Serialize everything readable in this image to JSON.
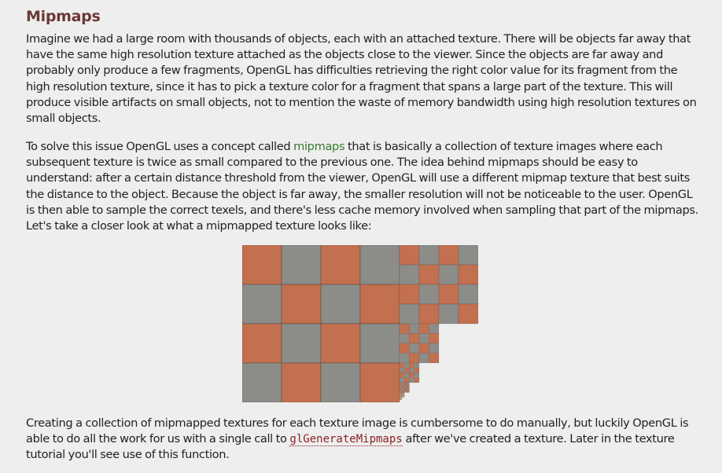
{
  "section": {
    "title": "Mipmaps"
  },
  "paragraphs": {
    "p1": "Imagine we had a large room with thousands of objects, each with an attached texture. There will be objects far away that have the same high resolution texture attached as the objects close to the viewer. Since the objects are far away and probably only produce a few fragments, OpenGL has difficulties retrieving the right color value for its fragment from the high resolution texture, since it has to pick a texture color for a fragment that spans a large part of the texture. This will produce visible artifacts on small objects, not to mention the waste of memory bandwidth using high resolution textures on small objects.",
    "p2_before": "To solve this issue OpenGL uses a concept called ",
    "p2_link": "mipmaps",
    "p2_after": " that is basically a collection of texture images where each subsequent texture is twice as small compared to the previous one. The idea behind mipmaps should be easy to understand: after a certain distance threshold from the viewer, OpenGL will use a different mipmap texture that best suits the distance to the object. Because the object is far away, the smaller resolution will not be noticeable to the user. OpenGL is then able to sample the correct texels, and there's less cache memory involved when sampling that part of the mipmaps. Let's take a closer look at what a mipmapped texture looks like:",
    "p3_before": "Creating a collection of mipmapped textures for each texture image is cumbersome to do manually, but luckily OpenGL is able to do all the work for us with a single call to ",
    "p3_code": "glGenerateMipmaps",
    "p3_after": " after we've created a texture. Later in the texture tutorial you'll see use of this function."
  },
  "figure": {
    "tile_colors": {
      "orange": "#c2704f",
      "gray": "#8c8c88"
    }
  }
}
